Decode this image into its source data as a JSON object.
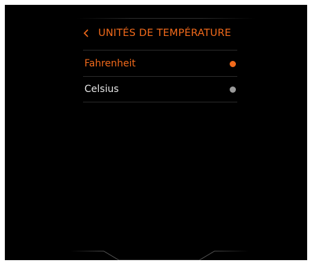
{
  "header": {
    "back_icon": "chevron-left-icon",
    "title": "UNITÉS DE TEMPÉRATURE"
  },
  "options": [
    {
      "label": "Fahrenheit",
      "selected": true,
      "label_color": "#f26a1b",
      "dot_color": "#f26a1b"
    },
    {
      "label": "Celsius",
      "selected": false,
      "label_color": "#e8e8e8",
      "dot_color": "#9a9a9a"
    }
  ],
  "colors": {
    "accent": "#f26a1b",
    "background": "#000000",
    "divider": "#2a2a2a"
  }
}
